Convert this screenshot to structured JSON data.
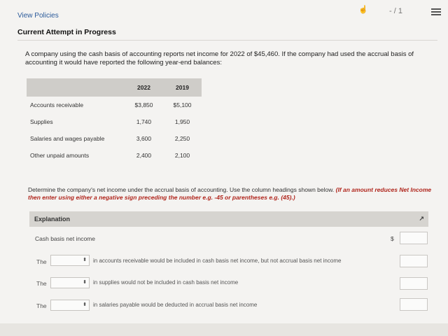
{
  "header": {
    "view_policies": "View Policies",
    "score": "- / 1",
    "attempt_title": "Current Attempt in Progress"
  },
  "question": {
    "text": "A company using the cash basis of accounting reports net income for 2022 of $45,460. If the company had used the accrual basis of accounting it would have reported the following year-end balances:"
  },
  "balances_table": {
    "headers": [
      "",
      "2022",
      "2019"
    ],
    "rows": [
      {
        "label": "Accounts receivable",
        "y2022": "$3,850",
        "y2019": "$5,100"
      },
      {
        "label": "Supplies",
        "y2022": "1,740",
        "y2019": "1,950"
      },
      {
        "label": "Salaries and wages payable",
        "y2022": "3,600",
        "y2019": "2,250"
      },
      {
        "label": "Other unpaid amounts",
        "y2022": "2,400",
        "y2019": "2,100"
      }
    ]
  },
  "instructions": {
    "text": "Determine the company's net income under the accrual basis of accounting. Use the column headings shown below.",
    "note": "(If an amount reduces Net Income then enter using either a negative sign preceding the number e.g. -45 or parentheses e.g. (45).)"
  },
  "explanation": {
    "header": "Explanation",
    "cash_label": "Cash basis net income",
    "dollar": "$",
    "rows": [
      {
        "prefix": "The",
        "text": "in accounts receivable would be included in cash basis net income, but not accrual basis net income"
      },
      {
        "prefix": "The",
        "text": "in supplies would not be included in cash basis net income"
      },
      {
        "prefix": "The",
        "text": "in salaries payable would be deducted in accrual basis net income"
      }
    ]
  }
}
